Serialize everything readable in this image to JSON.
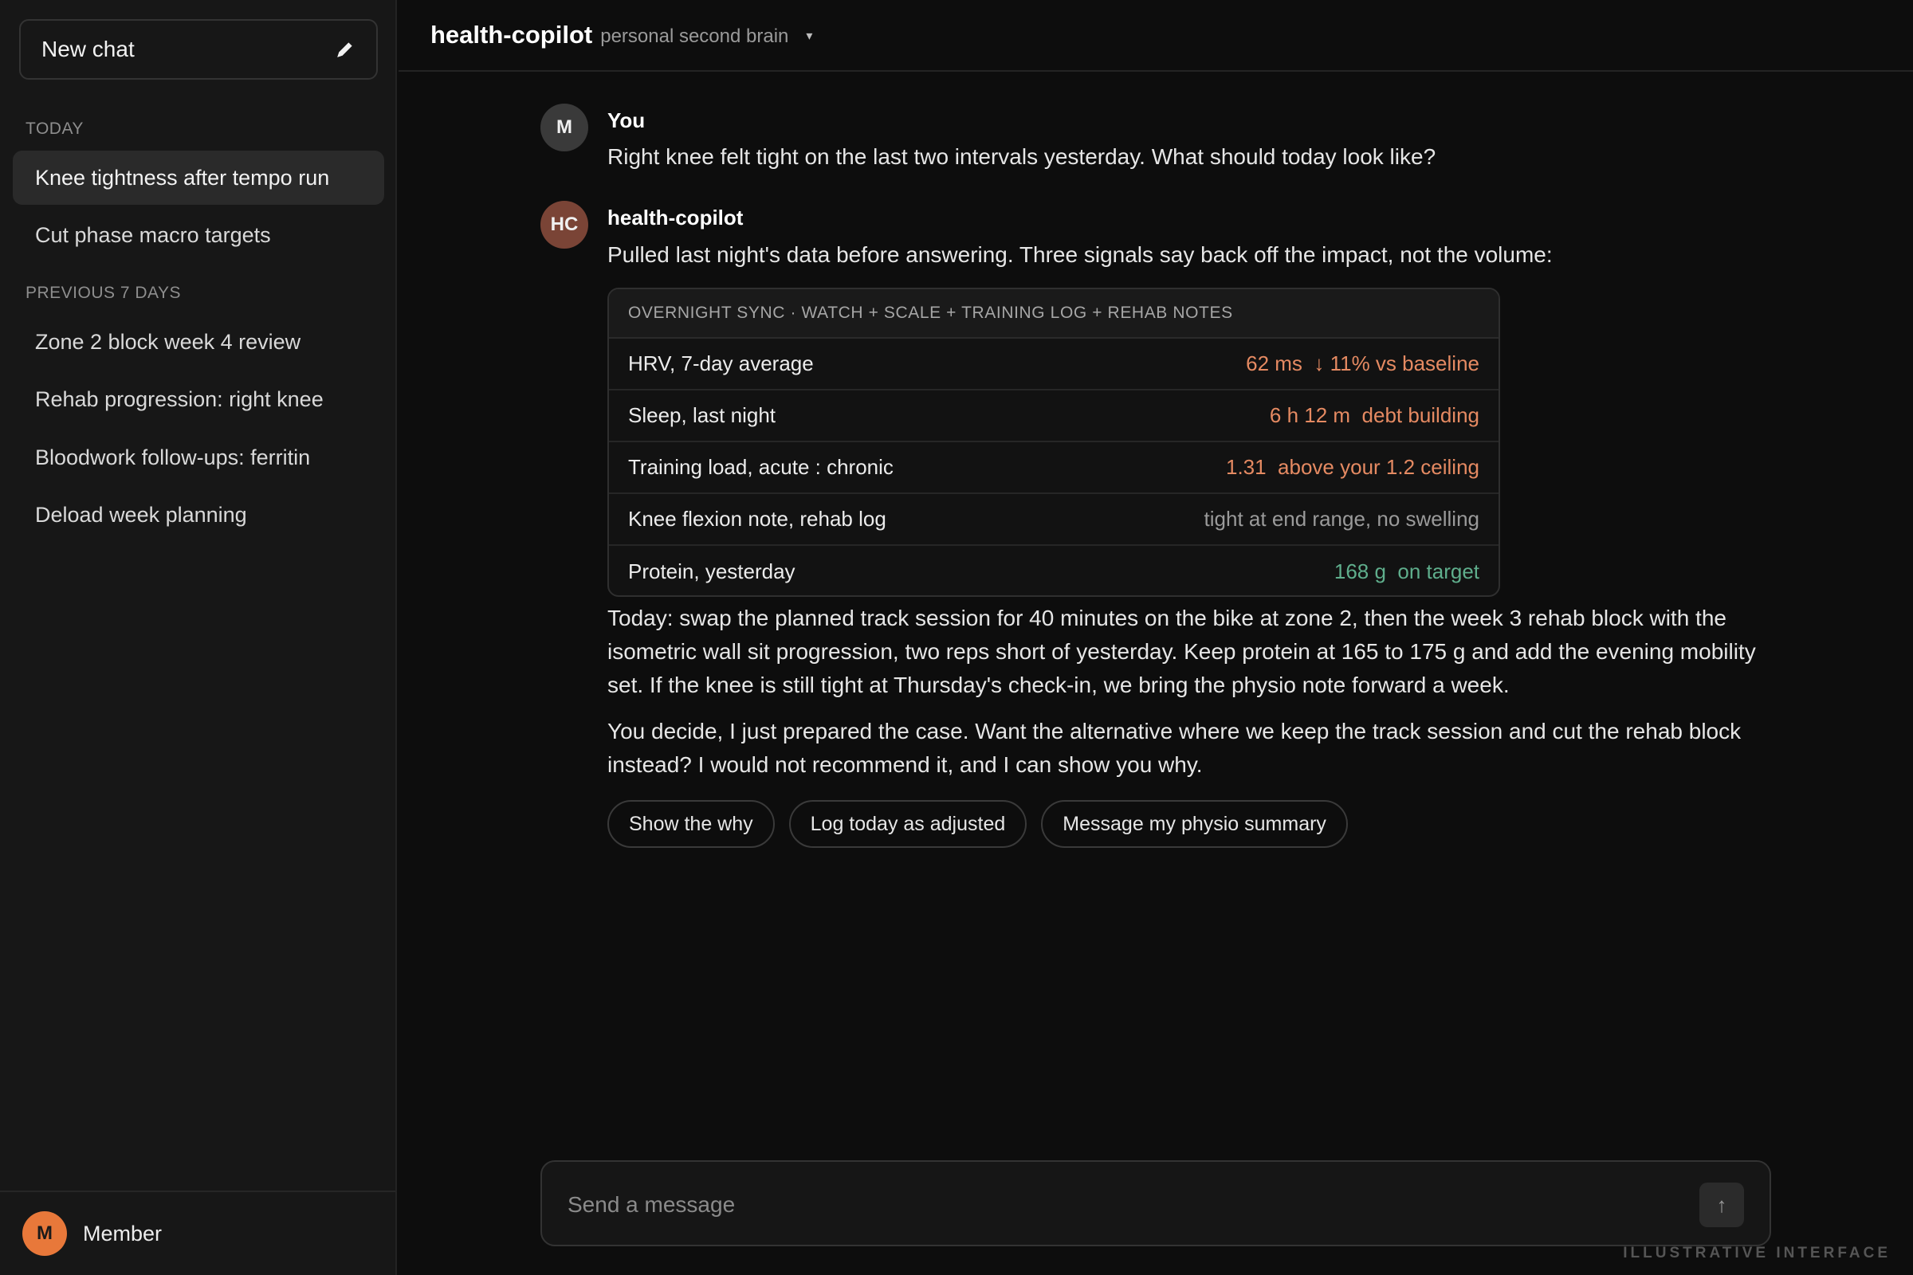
{
  "sidebar": {
    "new_chat_label": "New chat",
    "sections": [
      {
        "label": "Today",
        "items": [
          "Knee tightness after tempo run",
          "Cut phase macro targets"
        ]
      },
      {
        "label": "Previous 7 days",
        "items": [
          "Zone 2 block week 4 review",
          "Rehab progression: right knee",
          "Bloodwork follow-ups: ferritin",
          "Deload week planning"
        ]
      }
    ],
    "active_item": "Knee tightness after tempo run",
    "footer": {
      "avatar_initial": "M",
      "name": "Member"
    }
  },
  "header": {
    "title": "health-copilot",
    "subtitle": "personal second brain",
    "caret": "▾"
  },
  "conversation": {
    "user": {
      "avatar_initial": "M",
      "author": "You",
      "text": "Right knee felt tight on the last two intervals yesterday. What should today look like?"
    },
    "assistant": {
      "avatar_initial": "HC",
      "author": "health-copilot",
      "intro": "Pulled last night's data before answering. Three signals say back off the impact, not the volume:",
      "card": {
        "title": "Overnight sync · watch + scale + training log + rehab notes",
        "rows": [
          {
            "label": "HRV, 7-day average",
            "value": "62 ms  ↓ 11% vs baseline",
            "status": "warn"
          },
          {
            "label": "Sleep, last night",
            "value": "6 h 12 m  debt building",
            "status": "warn"
          },
          {
            "label": "Training load, acute : chronic",
            "value": "1.31  above your 1.2 ceiling",
            "status": "warn"
          },
          {
            "label": "Knee flexion note, rehab log",
            "value": "tight at end range, no swelling",
            "status": "neutral"
          },
          {
            "label": "Protein, yesterday",
            "value": "168 g  on target",
            "status": "good"
          }
        ]
      },
      "plan": "Today: swap the planned track session for 40 minutes on the bike at zone 2, then the week 3 rehab block with the isometric wall sit progression, two reps short of yesterday. Keep protein at 165 to 175 g and add the evening mobility set. If the knee is still tight at Thursday's check-in, we bring the physio note forward a week.",
      "closing": "You decide, I just prepared the case. Want the alternative where we keep the track session and cut the rehab block instead? I would not recommend it, and I can show you why.",
      "actions": [
        "Show the why",
        "Log today as adjusted",
        "Message my physio summary"
      ]
    }
  },
  "composer": {
    "placeholder": "Send a message",
    "send_icon": "↑"
  },
  "colors": {
    "warn": "#e58a62",
    "neutral": "#9a9a9a",
    "good": "#5fae8c",
    "user_avatar": "#e8783a",
    "bot_avatar": "#7a4436"
  },
  "watermark": "Illustrative interface"
}
